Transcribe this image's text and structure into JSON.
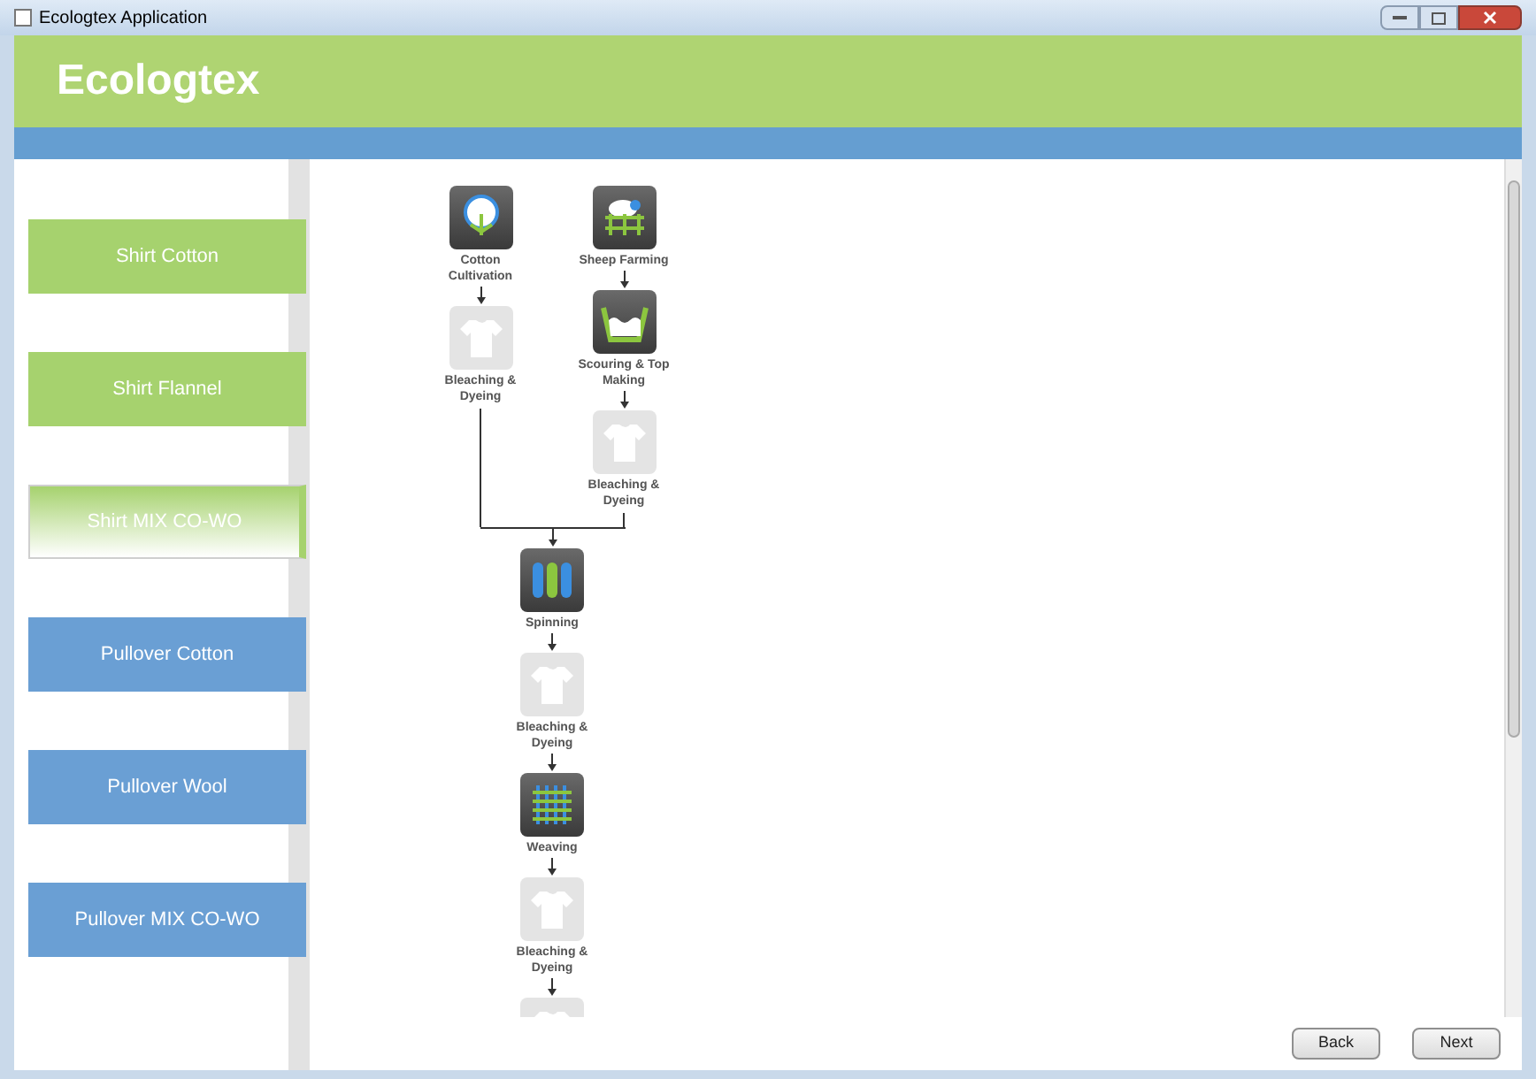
{
  "window": {
    "title": "Ecologtex Application"
  },
  "header": {
    "title": "Ecologtex"
  },
  "sidebar": {
    "items": [
      {
        "label": "Shirt Cotton",
        "color": "#a6d26e",
        "selected": false
      },
      {
        "label": "Shirt Flannel",
        "color": "#a6d26e",
        "selected": false
      },
      {
        "label": "Shirt MIX CO-WO",
        "color": "#a6d26e",
        "selected": true
      },
      {
        "label": "Pullover Cotton",
        "color": "#6a9fd4",
        "selected": false
      },
      {
        "label": "Pullover Wool",
        "color": "#6a9fd4",
        "selected": false
      },
      {
        "label": "Pullover MIX CO-WO",
        "color": "#6a9fd4",
        "selected": false
      }
    ]
  },
  "diagram": {
    "branches": [
      [
        {
          "kind": "cotton",
          "label": "Cotton Cultivation",
          "active": true
        },
        {
          "kind": "bleach",
          "label": "Bleaching & Dyeing",
          "active": false
        }
      ],
      [
        {
          "kind": "sheep",
          "label": "Sheep Farming",
          "active": true
        },
        {
          "kind": "scour",
          "label": "Scouring & Top Making",
          "active": true
        },
        {
          "kind": "bleach",
          "label": "Bleaching & Dyeing",
          "active": false
        }
      ]
    ],
    "chain": [
      {
        "kind": "spin",
        "label": "Spinning",
        "active": true
      },
      {
        "kind": "bleach",
        "label": "Bleaching & Dyeing",
        "active": false
      },
      {
        "kind": "weave",
        "label": "Weaving",
        "active": true
      },
      {
        "kind": "bleach",
        "label": "Bleaching & Dyeing",
        "active": false
      },
      {
        "kind": "bleach",
        "active": false
      }
    ]
  },
  "buttons": [
    {
      "label": "Back"
    },
    {
      "label": "Next"
    }
  ]
}
